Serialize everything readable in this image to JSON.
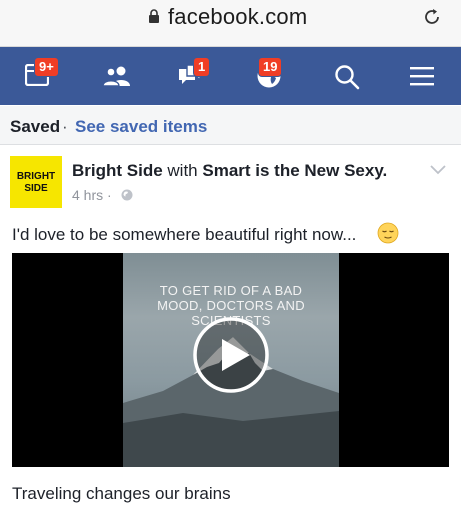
{
  "browser": {
    "url": "facebook.com"
  },
  "nav": {
    "items": [
      {
        "name": "feed",
        "badge": "9+"
      },
      {
        "name": "friend-requests",
        "badge": ""
      },
      {
        "name": "messages",
        "badge": "1"
      },
      {
        "name": "notifications",
        "badge": "19"
      },
      {
        "name": "search",
        "badge": ""
      },
      {
        "name": "menu",
        "badge": ""
      }
    ],
    "background": "#3b5998",
    "badge_color": "#f03d25"
  },
  "saved": {
    "label": "Saved",
    "separator": "·",
    "link": "See saved items"
  },
  "post": {
    "logo_line1": "BRIGHT",
    "logo_line2": "SIDE",
    "author": "Bright Side",
    "with_text": "with",
    "coauthor": "Smart is the New Sexy.",
    "time": "4 hrs ·",
    "text": "I'd love to be somewhere beautiful right now...",
    "video_text_line1": "TO GET RID OF A BAD",
    "video_text_line2": "MOOD, DOCTORS AND",
    "video_text_line3": "SCIENTISTS",
    "caption": "Traveling changes our brains"
  }
}
